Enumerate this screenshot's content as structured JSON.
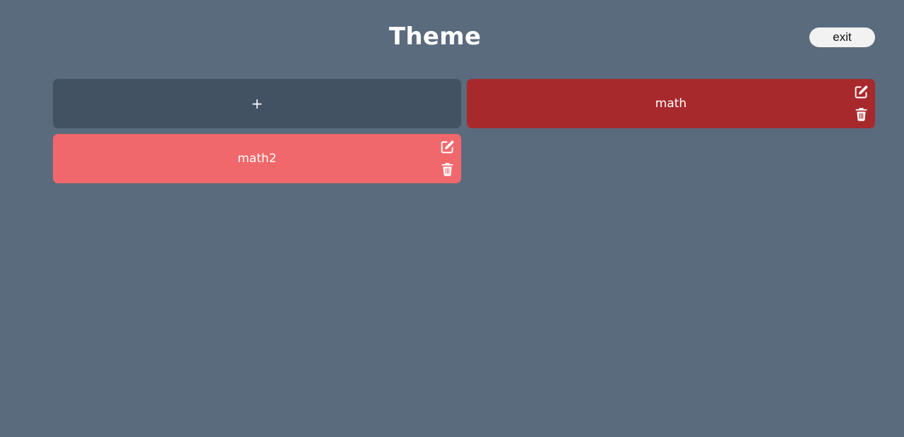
{
  "header": {
    "title": "Theme",
    "exit_label": "exit"
  },
  "cards": [
    {
      "label": "+",
      "kind": "add"
    },
    {
      "label": "math",
      "color": "#a8292c",
      "actions": [
        "edit-icon",
        "trash-icon"
      ]
    },
    {
      "label": "math2",
      "color": "#f0686b",
      "actions": [
        "edit-icon",
        "trash-icon"
      ]
    }
  ],
  "colors": {
    "background": "#5a6b7d",
    "add_card": "#435263",
    "text": "#ffffff"
  }
}
